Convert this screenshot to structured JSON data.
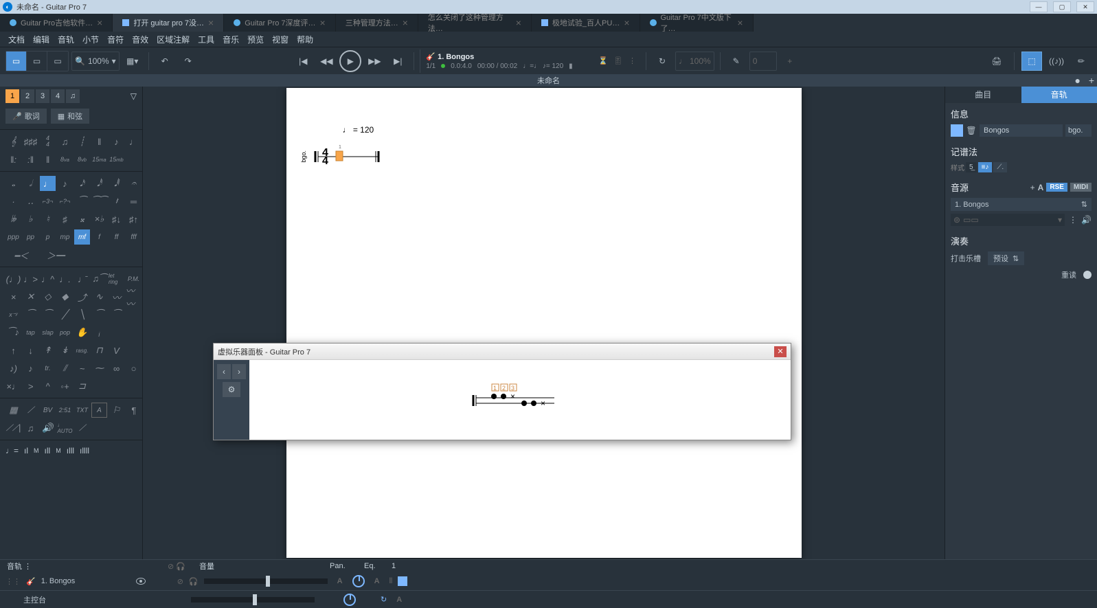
{
  "app": {
    "title": "未命名 - Guitar Pro 7"
  },
  "browser_tabs": [
    {
      "label": "Guitar Pro吉他软件…",
      "active": false
    },
    {
      "label": "打开 guitar pro 7没…",
      "active": true
    },
    {
      "label": "Guitar Pro 7深度评…",
      "active": false
    },
    {
      "label": "三种管理方法…",
      "active": false
    },
    {
      "label": "怎么关闭了这种管理方法…",
      "active": false
    },
    {
      "label": "极地试验_百人PU…",
      "active": false
    },
    {
      "label": "Guitar Pro 7中文版下了…",
      "active": false
    }
  ],
  "menubar": [
    "文档",
    "编辑",
    "音轨",
    "小节",
    "音符",
    "音效",
    "区域注解",
    "工具",
    "音乐",
    "预览",
    "视窗",
    "帮助"
  ],
  "toolbar": {
    "zoom": "100%",
    "track": {
      "title": "1. Bongos",
      "measure": "1/1",
      "pos": "0.0:4.0",
      "time": "00:00 / 00:02",
      "tempo": "= 120"
    },
    "tempo_display": "100%",
    "pitch": "0"
  },
  "doc_title": "未命名",
  "left": {
    "tabs": [
      "1",
      "2",
      "3",
      "4"
    ],
    "lyrics": "歌词",
    "chords": "和弦",
    "dynamics": [
      "ppp",
      "pp",
      "p",
      "mp",
      "mf",
      "f",
      "ff",
      "fff"
    ],
    "misc_labels": {
      "bv": "BV",
      "t251": "2:51",
      "txt": "TXT",
      "a": "A",
      "tap": "tap",
      "slap": "slap",
      "pop": "pop",
      "rasg": "rasg.",
      "pm": "P.M.",
      "let": "let ring",
      "tr": "tr."
    },
    "levels": [
      "M",
      "M"
    ]
  },
  "canvas": {
    "tempo": "= 120",
    "time_sig_top": "4",
    "time_sig_bot": "4",
    "staff_label": "bgo."
  },
  "dialog": {
    "title": "虚拟乐器面板 - Guitar Pro 7",
    "numbers": [
      "1",
      "2",
      "3"
    ]
  },
  "right": {
    "tabs": {
      "song": "曲目",
      "track": "音轨"
    },
    "info": {
      "title": "信息",
      "name": "Bongos",
      "short": "bgo."
    },
    "notation": {
      "title": "记谱法",
      "mode": "样式",
      "num": "5"
    },
    "sound": {
      "title": "音源",
      "rse": "RSE",
      "midi": "MIDI",
      "bank": "1. Bongos",
      "a": "A"
    },
    "perf": {
      "title": "演奏",
      "percussion": "打击乐槽",
      "preset": "预设",
      "accent": "重读"
    }
  },
  "bottom": {
    "track_header": "音轨",
    "vol_header": "音量",
    "pan_header": "Pan.",
    "eq_header": "Eq.",
    "num_header": "1",
    "track_name": "1. Bongos",
    "master": "主控台",
    "a": "A"
  }
}
